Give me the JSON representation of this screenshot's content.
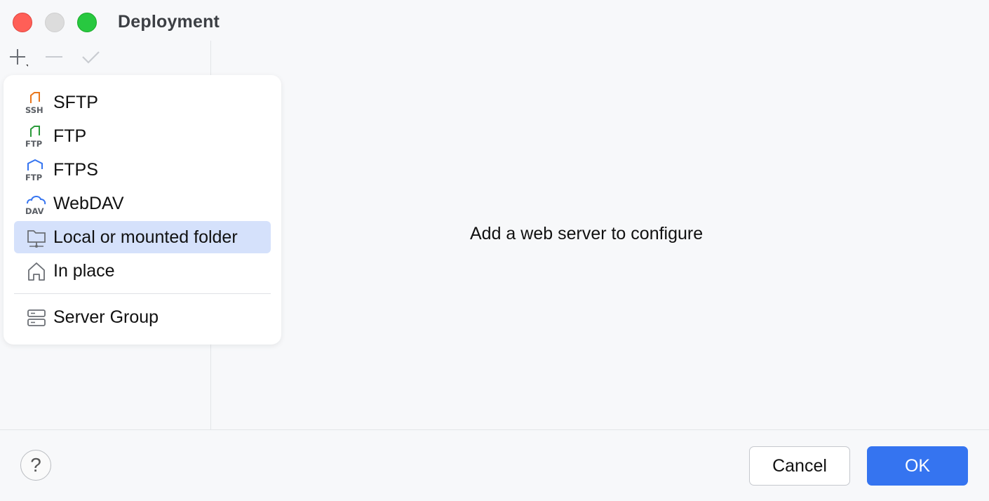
{
  "window": {
    "title": "Deployment"
  },
  "toolbar": {
    "add": "plus-icon",
    "remove": "minus-icon",
    "apply": "check-icon"
  },
  "main": {
    "empty_text": "Add a web server to configure"
  },
  "menu": {
    "items": [
      {
        "label": "SFTP",
        "icon": "sftp-icon",
        "icon_text": "SSH"
      },
      {
        "label": "FTP",
        "icon": "ftp-icon",
        "icon_text": "FTP"
      },
      {
        "label": "FTPS",
        "icon": "ftps-icon",
        "icon_text": "FTP"
      },
      {
        "label": "WebDAV",
        "icon": "webdav-icon",
        "icon_text": "DAV"
      },
      {
        "label": "Local or mounted folder",
        "icon": "folder-icon"
      },
      {
        "label": "In place",
        "icon": "home-icon"
      },
      {
        "label": "Server Group",
        "icon": "server-group-icon"
      }
    ],
    "selected": "Local or mounted folder"
  },
  "footer": {
    "help": "?",
    "cancel_label": "Cancel",
    "ok_label": "OK"
  },
  "colors": {
    "accent": "#3574f0",
    "selection": "#d5e1fb",
    "sftp": "#e8761c",
    "ftp": "#2a9a3a",
    "ftps": "#3574f0",
    "webdav": "#3574f0"
  }
}
